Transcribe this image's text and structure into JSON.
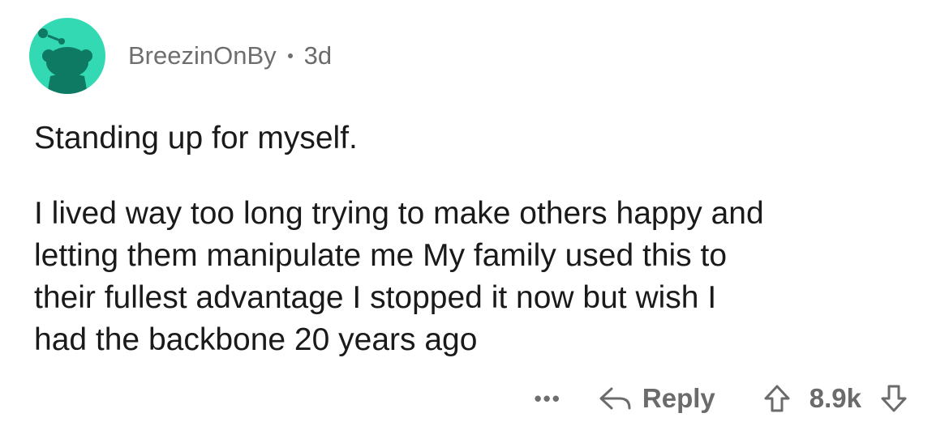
{
  "comment": {
    "username": "BreezinOnBy",
    "age": "3d",
    "title": "Standing up for myself.",
    "body_lines": [
      "I lived way too long trying to make others happy and",
      "letting them manipulate me My family used this to",
      "their fullest advantage I stopped it now but wish I",
      "had the backbone 20 years ago"
    ]
  },
  "actions": {
    "more": "•••",
    "reply_label": "Reply",
    "score": "8.9k",
    "upvote_icon": "upvote-arrow-icon",
    "downvote_icon": "downvote-arrow-icon",
    "reply_icon": "reply-arrow-icon",
    "avatar_icon": "snoo-avatar-icon"
  },
  "colors": {
    "avatar_bg": "#33d9b2",
    "muted_text": "#6b6b6b",
    "body_text": "#1a1a1b"
  }
}
